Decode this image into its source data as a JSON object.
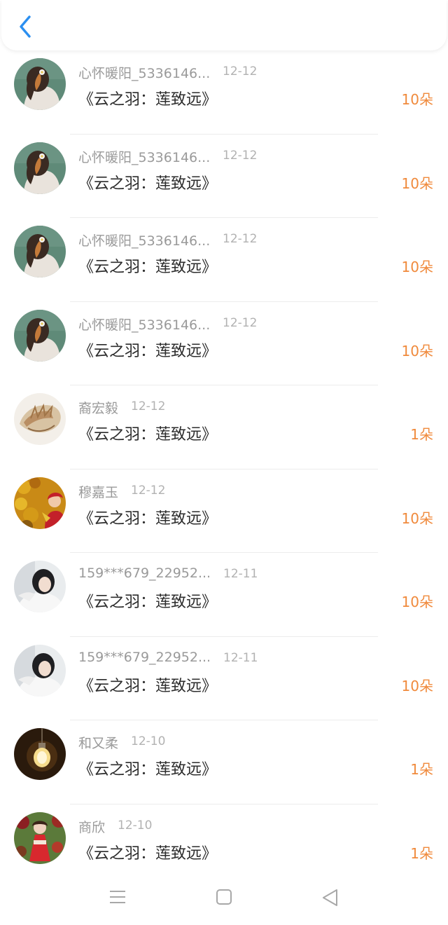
{
  "header": {
    "back_icon": "chevron-left-icon",
    "accent_color": "#2b8ff0"
  },
  "rows": [
    {
      "name": "心怀暖阳_5336146...",
      "date": "12-12",
      "gift": "《云之羽：莲致远》",
      "count": "10朵",
      "avatar": "girl-with-flower"
    },
    {
      "name": "心怀暖阳_5336146...",
      "date": "12-12",
      "gift": "《云之羽：莲致远》",
      "count": "10朵",
      "avatar": "girl-with-flower"
    },
    {
      "name": "心怀暖阳_5336146...",
      "date": "12-12",
      "gift": "《云之羽：莲致远》",
      "count": "10朵",
      "avatar": "girl-with-flower"
    },
    {
      "name": "心怀暖阳_5336146...",
      "date": "12-12",
      "gift": "《云之羽：莲致远》",
      "count": "10朵",
      "avatar": "girl-with-flower"
    },
    {
      "name": "裔宏毅",
      "date": "12-12",
      "gift": "《云之羽：莲致远》",
      "count": "1朵",
      "avatar": "seashell"
    },
    {
      "name": "穆嘉玉",
      "date": "12-12",
      "gift": "《云之羽：莲致远》",
      "count": "10朵",
      "avatar": "woman-autumn-leaves"
    },
    {
      "name": "159***679_22952...",
      "date": "12-11",
      "gift": "《云之羽：莲致远》",
      "count": "10朵",
      "avatar": "girl-white-sweater"
    },
    {
      "name": "159***679_22952...",
      "date": "12-11",
      "gift": "《云之羽：莲致远》",
      "count": "10朵",
      "avatar": "girl-white-sweater"
    },
    {
      "name": "和又柔",
      "date": "12-10",
      "gift": "《云之羽：莲致远》",
      "count": "1朵",
      "avatar": "light-bulb"
    },
    {
      "name": "商欣",
      "date": "12-10",
      "gift": "《云之羽：莲致远》",
      "count": "1朵",
      "avatar": "girl-red-dress"
    }
  ],
  "colors": {
    "count": "#f08a3c",
    "name": "#9a9a9a",
    "date": "#b2b2b2",
    "gift": "#2c2c2c"
  },
  "navbar": {
    "icons": [
      "menu-icon",
      "home-square-icon",
      "back-triangle-icon"
    ]
  }
}
